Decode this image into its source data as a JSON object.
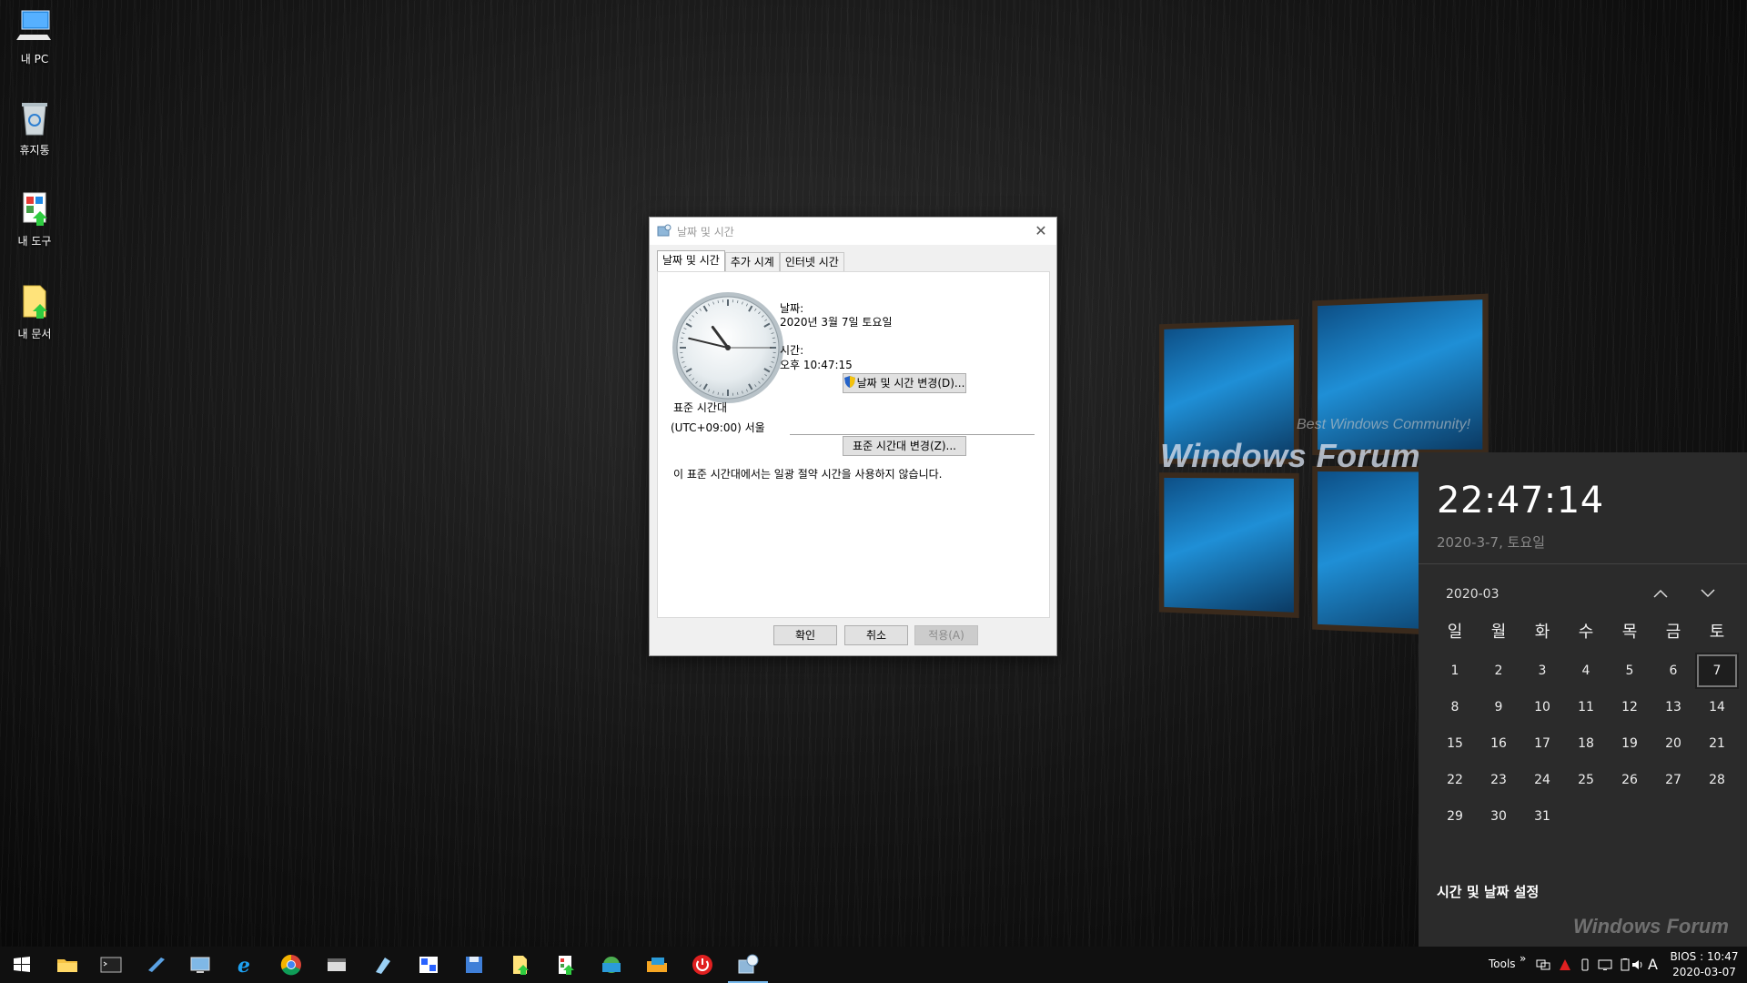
{
  "desktop": {
    "icons": [
      {
        "label": "내 PC",
        "icon": "computer-icon"
      },
      {
        "label": "휴지통",
        "icon": "recycle-bin-icon"
      },
      {
        "label": "내 도구",
        "icon": "tools-folder-icon"
      },
      {
        "label": "내 문서",
        "icon": "documents-folder-icon"
      }
    ],
    "wallpaper_text": "Windows Forum",
    "wallpaper_subtext": "Best Windows Community!"
  },
  "dialog": {
    "title": "날짜 및 시간",
    "tabs": [
      "날짜 및 시간",
      "추가 시계",
      "인터넷 시간"
    ],
    "active_tab": 0,
    "date_label": "날짜:",
    "date_value": "2020년 3월 7일 토요일",
    "time_label": "시간:",
    "time_value": "오후 10:47:15",
    "change_datetime_button": "날짜 및 시간 변경(D)...",
    "timezone_label": "표준 시간대",
    "timezone_value": "(UTC+09:00) 서울",
    "change_timezone_button": "표준 시간대 변경(Z)...",
    "dst_note": "이 표준 시간대에서는 일광 절약 시간을 사용하지 않습니다.",
    "ok_button": "확인",
    "cancel_button": "취소",
    "apply_button": "적용(A)"
  },
  "clock_face": {
    "hour": 10,
    "minute": 47,
    "second": 15
  },
  "flyout": {
    "time": "22:47:14",
    "date": "2020-3-7, 토요일",
    "month": "2020-03",
    "weekdays": [
      "일",
      "월",
      "화",
      "수",
      "목",
      "금",
      "토"
    ],
    "weeks": [
      [
        "1",
        "2",
        "3",
        "4",
        "5",
        "6",
        "7"
      ],
      [
        "8",
        "9",
        "10",
        "11",
        "12",
        "13",
        "14"
      ],
      [
        "15",
        "16",
        "17",
        "18",
        "19",
        "20",
        "21"
      ],
      [
        "22",
        "23",
        "24",
        "25",
        "26",
        "27",
        "28"
      ],
      [
        "29",
        "30",
        "31",
        "",
        "",
        "",
        ""
      ]
    ],
    "today": "7",
    "settings_link": "시간 및 날짜 설정",
    "watermark": "Windows Forum"
  },
  "taskbar": {
    "apps": [
      "start-icon",
      "file-explorer-icon",
      "command-prompt-icon",
      "notepad-icon",
      "remote-desktop-icon",
      "internet-explorer-icon",
      "chrome-icon",
      "registry-editor-icon",
      "paint-icon",
      "snipping-tool-icon",
      "save-icon",
      "documents-icon",
      "tools-icon",
      "network-icon",
      "shutdown-icon",
      "date-time-icon"
    ],
    "tools_label": "Tools",
    "chevron": "»",
    "ime": "A",
    "clock_line1": "BIOS : 10:47",
    "clock_line2": "2020-03-07"
  },
  "colors": {
    "accent": "#76b9ed",
    "flyout_bg": "#2b2b2b",
    "taskbar_bg": "#101010"
  }
}
